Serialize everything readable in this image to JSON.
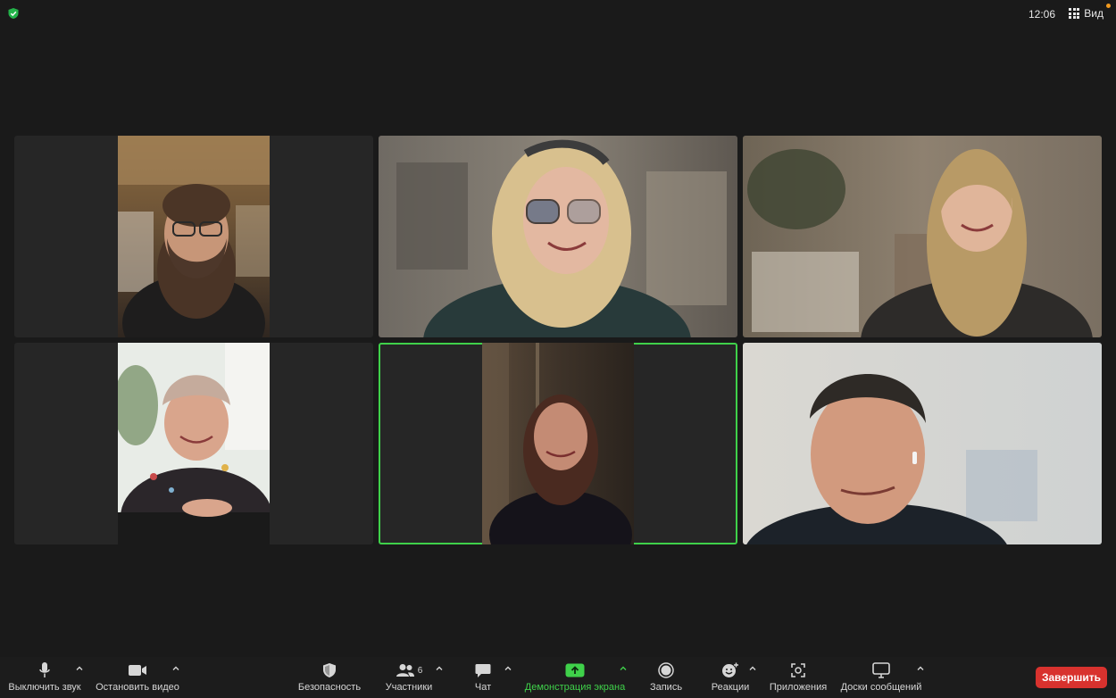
{
  "topbar": {
    "time": "12:06",
    "view_label": "Вид"
  },
  "participants": [
    {
      "id": "p1",
      "active": false
    },
    {
      "id": "p2",
      "active": false
    },
    {
      "id": "p3",
      "active": false
    },
    {
      "id": "p4",
      "active": false
    },
    {
      "id": "p5",
      "active": true
    },
    {
      "id": "p6",
      "active": false
    }
  ],
  "toolbar": {
    "mute_label": "Выключить звук",
    "video_label": "Остановить видео",
    "security_label": "Безопасность",
    "participants_label": "Участники",
    "participants_count": "6",
    "chat_label": "Чат",
    "share_label": "Демонстрация экрана",
    "record_label": "Запись",
    "reactions_label": "Реакции",
    "apps_label": "Приложения",
    "whiteboards_label": "Доски сообщений",
    "end_label": "Завершить"
  },
  "colors": {
    "accent_green": "#3fd14a",
    "end_red": "#d8322e",
    "notify_orange": "#f29a1e"
  }
}
